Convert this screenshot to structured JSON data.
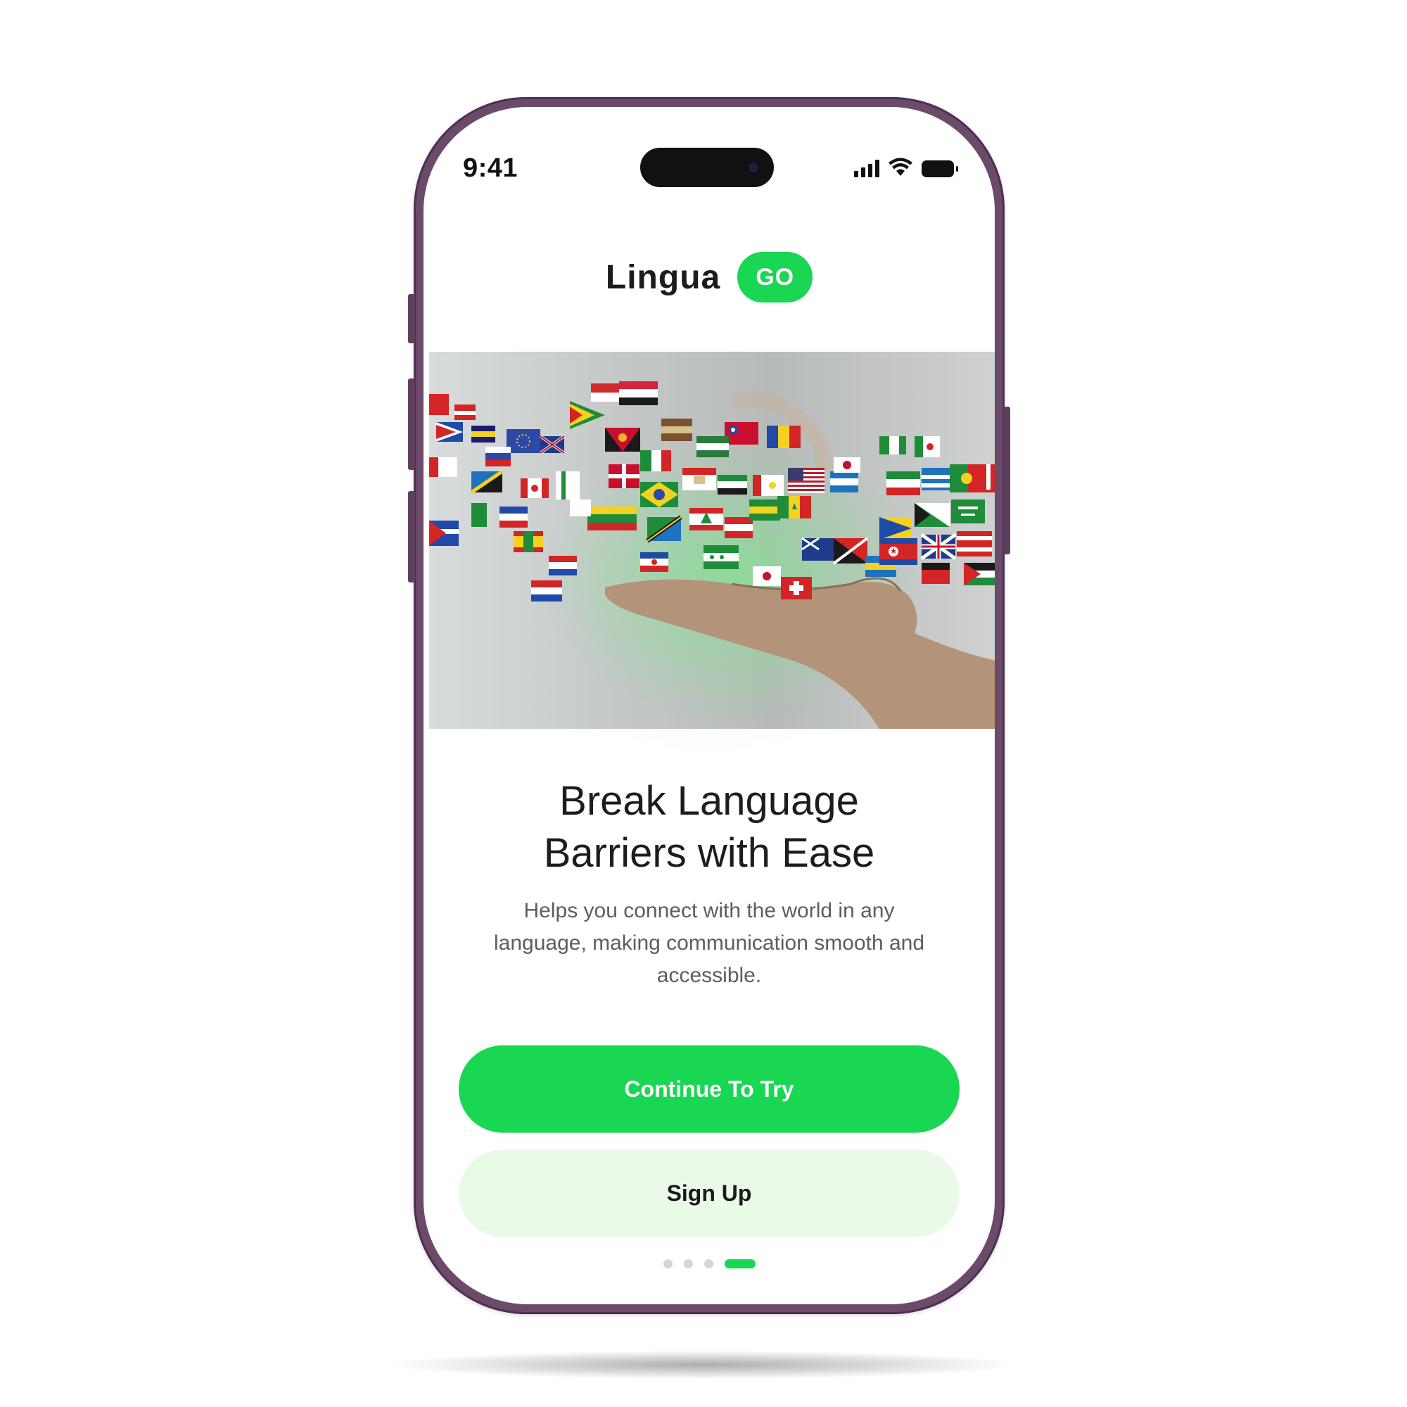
{
  "status_bar": {
    "time": "9:41",
    "icons": [
      "cellular-signal-icon",
      "wifi-icon",
      "battery-icon"
    ]
  },
  "logo": {
    "word": "Lingua",
    "badge": "GO"
  },
  "hero": {
    "image": "hand-with-floating-world-flags"
  },
  "content": {
    "headline_line1": "Break Language",
    "headline_line2": "Barriers with Ease",
    "subtext_line1": "Helps you connect with the world in any",
    "subtext_line2": "language, making communication smooth and",
    "subtext_line3": "accessible."
  },
  "buttons": {
    "primary_label": "Continue To Try",
    "secondary_label": "Sign Up"
  },
  "pagination": {
    "total": 4,
    "active_index": 3
  },
  "colors": {
    "accent": "#19d653",
    "secondary_button_bg": "#e9fbe7",
    "frame": "#6b4a6a"
  }
}
